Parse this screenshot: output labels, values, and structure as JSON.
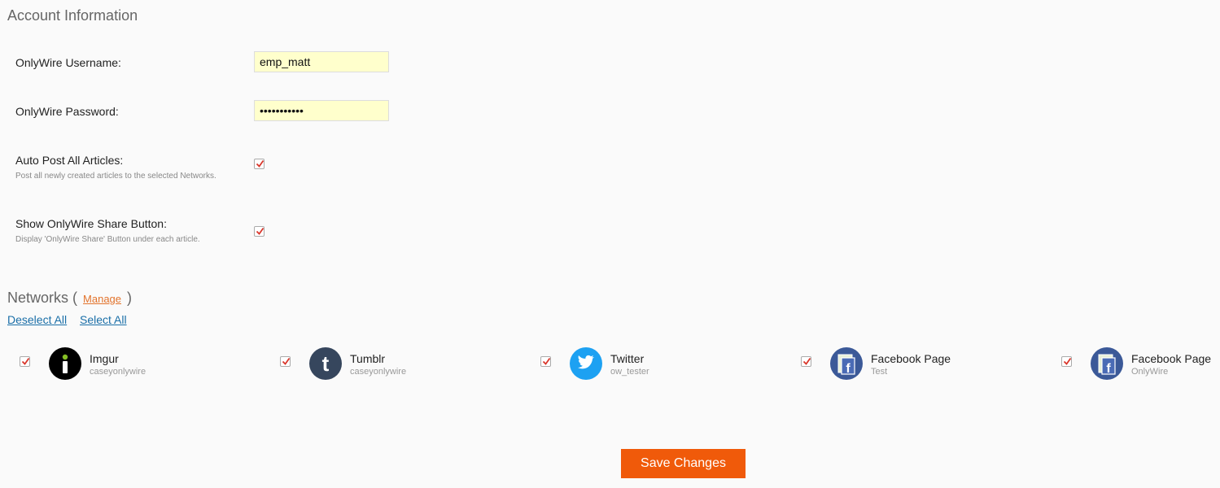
{
  "account": {
    "title": "Account Information",
    "username_label": "OnlyWire Username:",
    "username_value": "emp_matt",
    "password_label": "OnlyWire Password:",
    "password_value": "•••••••••••",
    "autopost_label": "Auto Post All Articles:",
    "autopost_desc": "Post all newly created articles to the selected Networks.",
    "autopost_checked": true,
    "share_label": "Show OnlyWire Share Button:",
    "share_desc": "Display 'OnlyWire Share' Button under each article.",
    "share_checked": true
  },
  "networks": {
    "title": "Networks (",
    "title_close": ")",
    "manage_label": "Manage",
    "deselect_all": "Deselect All",
    "select_all": "Select All",
    "items": [
      {
        "name": "Imgur",
        "account": "caseyonlywire",
        "icon": "imgur-icon",
        "color": "#000000",
        "checked": true
      },
      {
        "name": "Tumblr",
        "account": "caseyonlywire",
        "icon": "tumblr-icon",
        "color": "#36465d",
        "checked": true
      },
      {
        "name": "Twitter",
        "account": "ow_tester",
        "icon": "twitter-icon",
        "color": "#1da1f2",
        "checked": true
      },
      {
        "name": "Facebook Page",
        "account": "Test",
        "icon": "facebook-page-icon",
        "color": "#3b5998",
        "checked": true
      },
      {
        "name": "Facebook Page",
        "account": "OnlyWire",
        "icon": "facebook-page-icon",
        "color": "#3b5998",
        "checked": true
      }
    ]
  },
  "actions": {
    "save_label": "Save Changes",
    "save_color": "#f05a0a"
  }
}
